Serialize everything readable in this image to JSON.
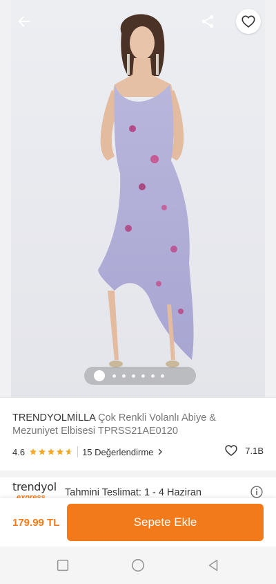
{
  "product": {
    "brand": "TRENDYOLMİLLA",
    "name": " Çok Renkli Volanlı Abiye & Mezuniyet Elbisesi TPRSS21AE0120",
    "rating": "4.6",
    "rating_stars": 4.6,
    "reviews_label": "15 Değerlendirme",
    "favorite_count": "7.1B",
    "price": "179.99 TL"
  },
  "gallery": {
    "current_index": 1,
    "total_images": 7
  },
  "delivery": {
    "logo_word": "trendyol",
    "logo_sub": "express",
    "text": "Tahmini Teslimat: 1 - 4 Haziran"
  },
  "actions": {
    "add_to_cart": "Sepete Ekle"
  },
  "colors": {
    "accent": "#f27a1a",
    "star": "#f5a623"
  }
}
